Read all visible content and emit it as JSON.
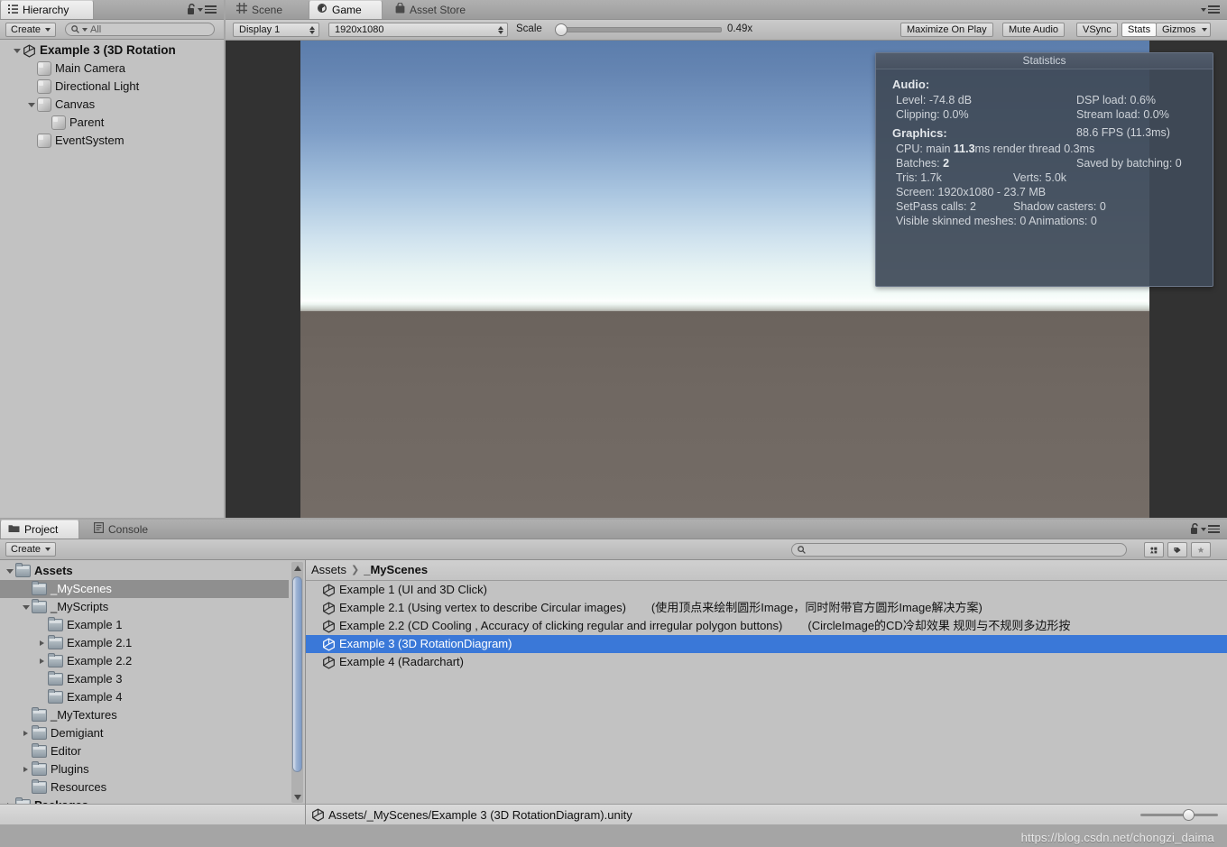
{
  "hierarchy": {
    "tab_label": "Hierarchy",
    "lock_icon": "lock-icon",
    "menu_icon": "hamburger-menu-icon",
    "create_label": "Create",
    "search_placeholder": "All",
    "search_value": "",
    "items": [
      {
        "label": "Example 3 (3D Rotation",
        "depth": 0,
        "icon": "unity-scene-icon",
        "expanded": true,
        "bold": true
      },
      {
        "label": "Main Camera",
        "depth": 1,
        "icon": "gameobject-cube-icon",
        "expanded": null,
        "bold": false
      },
      {
        "label": "Directional Light",
        "depth": 1,
        "icon": "gameobject-cube-icon",
        "expanded": null,
        "bold": false
      },
      {
        "label": "Canvas",
        "depth": 1,
        "icon": "gameobject-cube-icon",
        "expanded": true,
        "bold": false
      },
      {
        "label": "Parent",
        "depth": 2,
        "icon": "gameobject-cube-icon",
        "expanded": null,
        "bold": false
      },
      {
        "label": "EventSystem",
        "depth": 1,
        "icon": "gameobject-cube-icon",
        "expanded": null,
        "bold": false
      }
    ]
  },
  "gameview": {
    "tabs": [
      {
        "label": "Scene",
        "icon": "grid-icon",
        "active": false
      },
      {
        "label": "Game",
        "icon": "gamepad-icon",
        "active": true
      },
      {
        "label": "Asset Store",
        "icon": "store-bag-icon",
        "active": false
      }
    ],
    "menu_icon": "hamburger-menu-icon",
    "display_select": "Display 1",
    "resolution_select": "1920x1080",
    "scale_label": "Scale",
    "scale_value": "0.49x",
    "scale_percent": 3,
    "buttons": [
      {
        "label": "Maximize On Play",
        "active": false
      },
      {
        "label": "Mute Audio",
        "active": false
      },
      {
        "label": "VSync",
        "active": false
      },
      {
        "label": "Stats",
        "active": true
      },
      {
        "label": "Gizmos",
        "active": false
      }
    ]
  },
  "statistics": {
    "title": "Statistics",
    "audio_heading": "Audio:",
    "audio": [
      {
        "left": "Level: -74.8 dB",
        "right": "DSP load: 0.6%"
      },
      {
        "left": "Clipping: 0.0%",
        "right": "Stream load: 0.0%"
      }
    ],
    "graphics_heading": "Graphics:",
    "fps": "88.6 FPS (11.3ms)",
    "graphics": [
      {
        "left": "CPU: main ",
        "left_bold": "11.3",
        "left_tail": "ms  render thread 0.3ms",
        "right": ""
      },
      {
        "left": "Batches: ",
        "left_bold": "2",
        "left_tail": "",
        "right": "Saved by batching: 0"
      },
      {
        "left": "Tris: 1.7k",
        "left_bold": "",
        "left_tail": "",
        "right": "Verts: 5.0k"
      },
      {
        "left": "Screen: 1920x1080 - 23.7 MB",
        "left_bold": "",
        "left_tail": "",
        "right": ""
      },
      {
        "left": "SetPass calls: 2",
        "left_bold": "",
        "left_tail": "",
        "right": "Shadow casters: 0"
      },
      {
        "left": "Visible skinned meshes: 0  Animations: 0",
        "left_bold": "",
        "left_tail": "",
        "right": ""
      }
    ]
  },
  "project": {
    "tabs": [
      {
        "label": "Project",
        "icon": "folder-icon",
        "active": true
      },
      {
        "label": "Console",
        "icon": "console-icon",
        "active": false
      }
    ],
    "lock_icon": "lock-icon",
    "menu_icon": "hamburger-menu-icon",
    "create_label": "Create",
    "search_placeholder": "",
    "search_value": "",
    "filter_icons": [
      "filter-by-type-icon",
      "filter-by-label-icon",
      "favorites-star-icon"
    ],
    "tree": [
      {
        "label": "Assets",
        "depth": 0,
        "expanded": true,
        "bold": true,
        "selected": false
      },
      {
        "label": "_MyScenes",
        "depth": 1,
        "expanded": null,
        "bold": false,
        "selected": true
      },
      {
        "label": "_MyScripts",
        "depth": 1,
        "expanded": true,
        "bold": false,
        "selected": false
      },
      {
        "label": "Example 1",
        "depth": 2,
        "expanded": null,
        "bold": false,
        "selected": false
      },
      {
        "label": "Example 2.1",
        "depth": 2,
        "expanded": false,
        "bold": false,
        "selected": false
      },
      {
        "label": "Example 2.2",
        "depth": 2,
        "expanded": false,
        "bold": false,
        "selected": false
      },
      {
        "label": "Example 3",
        "depth": 2,
        "expanded": null,
        "bold": false,
        "selected": false
      },
      {
        "label": "Example 4",
        "depth": 2,
        "expanded": null,
        "bold": false,
        "selected": false
      },
      {
        "label": "_MyTextures",
        "depth": 1,
        "expanded": null,
        "bold": false,
        "selected": false
      },
      {
        "label": "Demigiant",
        "depth": 1,
        "expanded": false,
        "bold": false,
        "selected": false
      },
      {
        "label": "Editor",
        "depth": 1,
        "expanded": null,
        "bold": false,
        "selected": false
      },
      {
        "label": "Plugins",
        "depth": 1,
        "expanded": false,
        "bold": false,
        "selected": false
      },
      {
        "label": "Resources",
        "depth": 1,
        "expanded": null,
        "bold": false,
        "selected": false
      },
      {
        "label": "Packages",
        "depth": 0,
        "expanded": false,
        "bold": true,
        "selected": false
      }
    ],
    "breadcrumb": [
      {
        "label": "Assets",
        "bold": false
      },
      {
        "label": "_MyScenes",
        "bold": true
      }
    ],
    "assets": [
      {
        "name": "Example 1 (UI and 3D Click)",
        "note": "",
        "selected": false
      },
      {
        "name": "Example 2.1 (Using vertex to describe Circular images)",
        "note": "(使用顶点来绘制圆形Image，同时附带官方圆形Image解决方案)",
        "selected": false
      },
      {
        "name": "Example 2.2 (CD Cooling , Accuracy of clicking regular and irregular polygon buttons)",
        "note": "(CircleImage的CD冷却效果  规则与不规则多边形按",
        "selected": false
      },
      {
        "name": "Example 3 (3D RotationDiagram)",
        "note": "",
        "selected": true
      },
      {
        "name": "Example 4 (Radarchart)",
        "note": "",
        "selected": false
      }
    ],
    "status_path": "Assets/_MyScenes/Example 3 (3D RotationDiagram).unity",
    "status_icon": "unity-scene-icon",
    "zoom_percent": 62
  },
  "watermark": "https://blog.csdn.net/chongzi_daima",
  "colors": {
    "selection_blue": "#3a78d8",
    "tree_selection_gray": "#8f8f8f",
    "panel_bg": "#c2c2c2",
    "stats_bg": "#404a58",
    "letterbox": "#323232"
  }
}
